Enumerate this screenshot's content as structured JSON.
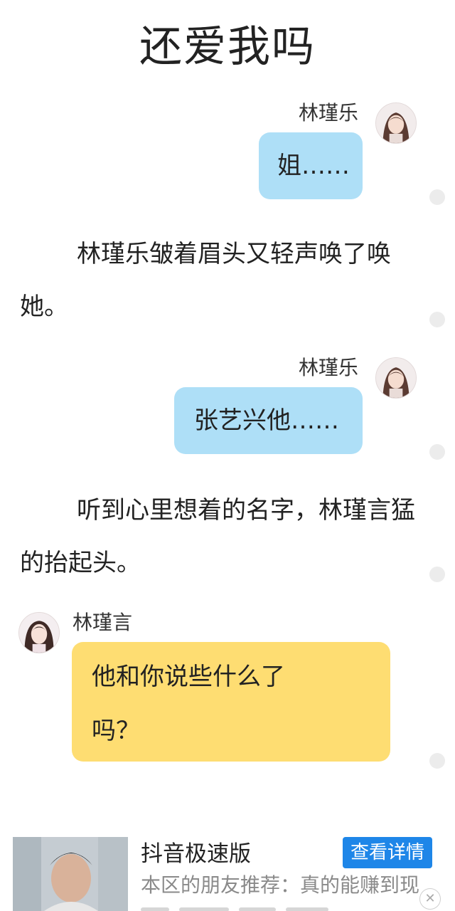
{
  "page": {
    "title": "还爱我吗"
  },
  "messages": [
    {
      "speaker": "林瑾乐",
      "text": "姐……"
    },
    {
      "speaker": "林瑾乐",
      "text": "张艺兴他……"
    },
    {
      "speaker": "林瑾言",
      "line1": "他和你说些什么了",
      "line2": "吗？"
    }
  ],
  "narration": [
    "林瑾乐皱着眉头又轻声唤了唤她。",
    "听到心里想着的名字，林瑾言猛的抬起头。"
  ],
  "ad": {
    "title": "抖音极速版",
    "button_label": "查看详情",
    "description": "本区的朋友推荐：真的能赚到现",
    "close_symbol": "✕"
  },
  "colors": {
    "bubble_blue": "#aedff7",
    "bubble_yellow": "#fedd72",
    "ad_button": "#1e86e8"
  },
  "icons": [
    "avatar-jinle-icon",
    "avatar-jinyan-icon",
    "close-icon"
  ]
}
